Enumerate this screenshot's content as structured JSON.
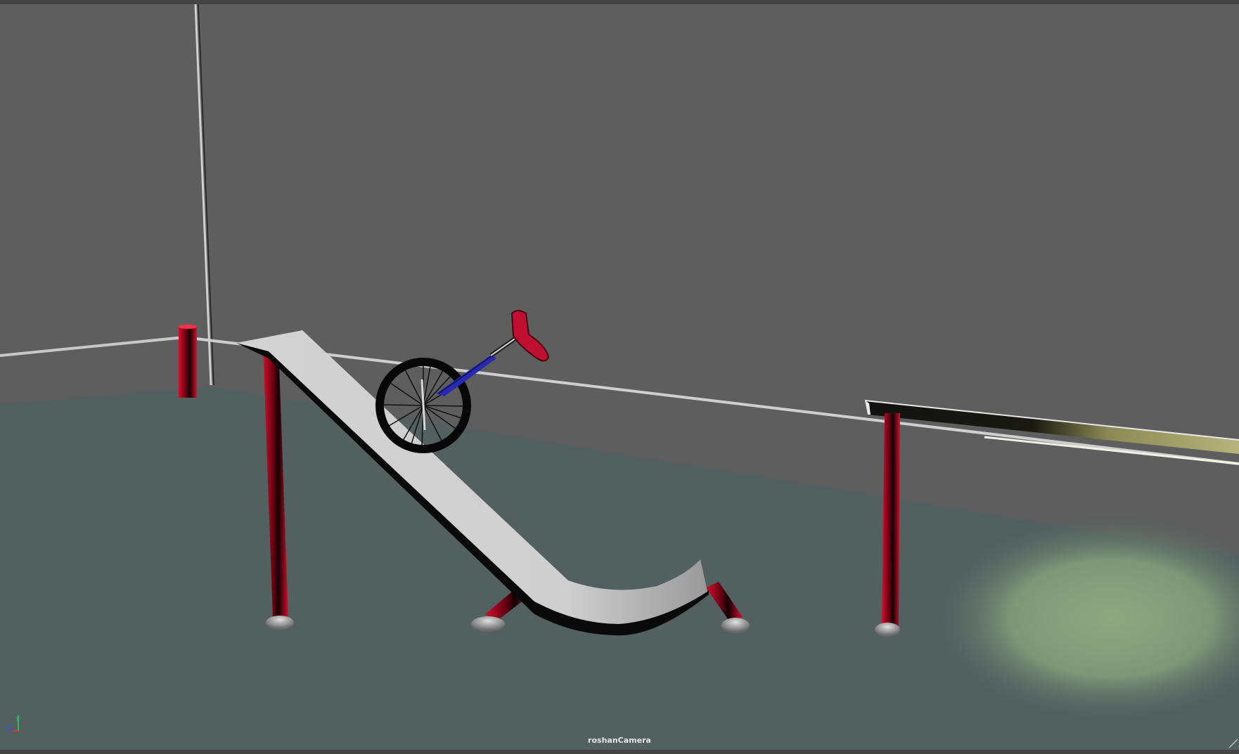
{
  "viewport": {
    "camera_name": "roshanCamera"
  },
  "scene": {
    "objects": [
      "ramp",
      "unicycle",
      "rail",
      "support-posts",
      "spotlight"
    ]
  },
  "colors": {
    "wall": "#5e5e5e",
    "floor": "#526060",
    "post_red": "#c4102a",
    "ramp_gray": "#c8c8c8",
    "light_green": "#8aa27c"
  },
  "icons": {
    "axis_gizmo": "xyz-axis-icon"
  }
}
